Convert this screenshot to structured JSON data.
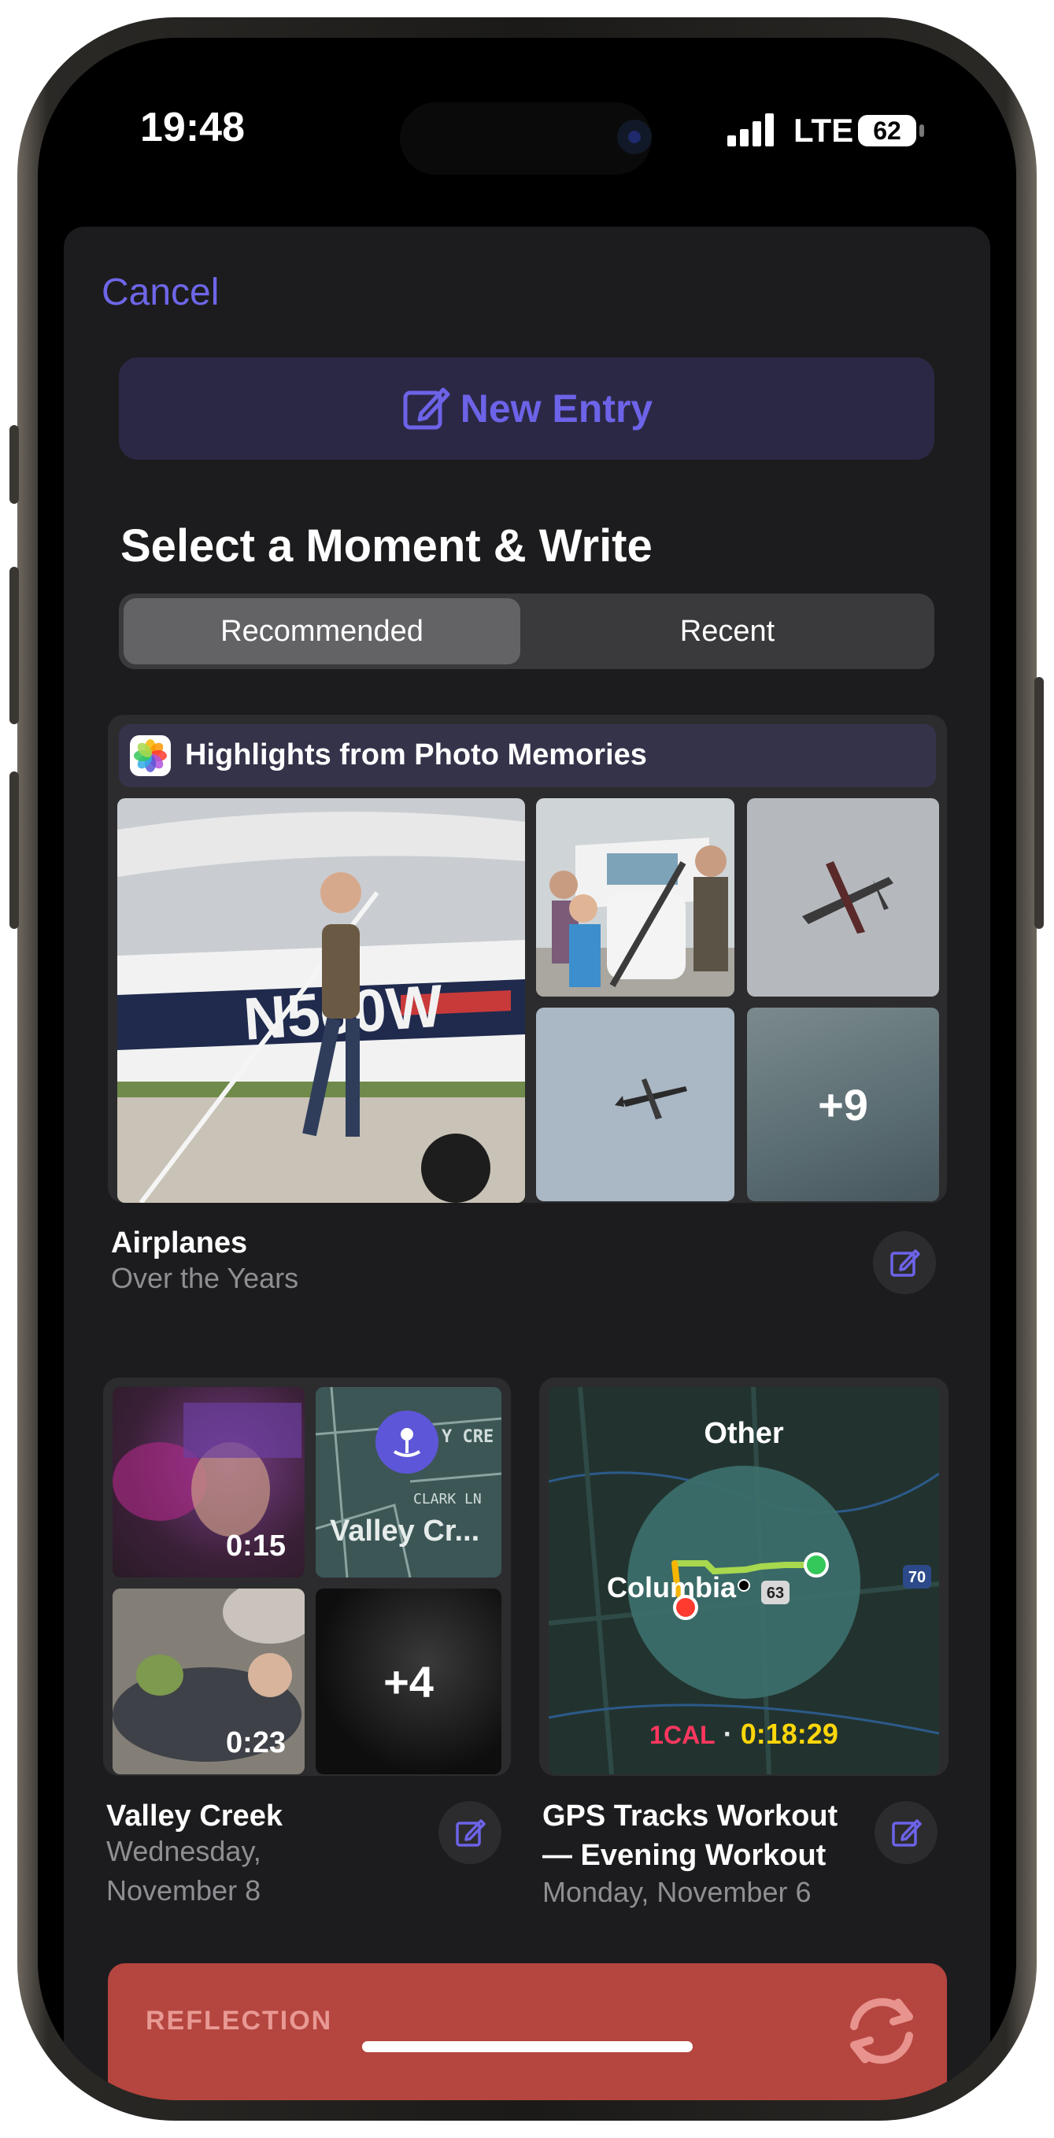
{
  "status_bar": {
    "time": "19:48",
    "network": "LTE",
    "battery": "62"
  },
  "header": {
    "cancel_label": "Cancel",
    "new_entry_label": "New Entry"
  },
  "section_title": "Select a Moment & Write",
  "segments": [
    {
      "label": "Recommended",
      "selected": true
    },
    {
      "label": "Recent",
      "selected": false
    }
  ],
  "memories": {
    "header": "Highlights from Photo Memories",
    "more_count": "+9",
    "title": "Airplanes",
    "subtitle": "Over the Years",
    "plane_registration": "N560W"
  },
  "valley_card": {
    "video1_duration": "0:15",
    "video2_duration": "0:23",
    "map_label": "Valley Cr...",
    "map_street_1": "Y CRE",
    "map_street_2": "CLARK LN",
    "more_count": "+4",
    "title": "Valley Creek",
    "subtitle_line1": "Wednesday,",
    "subtitle_line2": "November 8"
  },
  "workout_card": {
    "map_title": "Other",
    "city": "Columbia",
    "route_63": "63",
    "route_70": "70",
    "calories": "1CAL",
    "separator": "·",
    "duration": "0:18:29",
    "title_line1": "GPS Tracks Workout",
    "title_line2": "— Evening Workout",
    "subtitle": "Monday, November 6"
  },
  "reflection": {
    "label": "REFLECTION"
  },
  "colors": {
    "accent": "#6d63e8",
    "sheet_bg": "#1c1c1e",
    "reflection_bg": "#b5453f",
    "calorie_red": "#ff375f",
    "duration_yellow": "#ffd60a"
  }
}
